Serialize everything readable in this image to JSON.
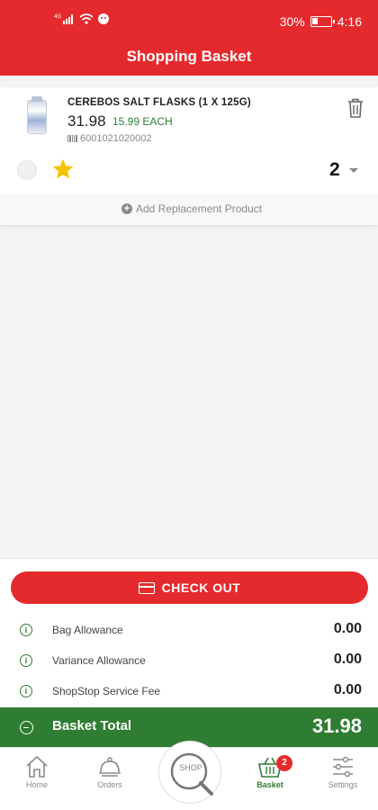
{
  "status_bar": {
    "battery": "30%",
    "time": "4:16",
    "network": "4G"
  },
  "header": {
    "title": "Shopping Basket"
  },
  "basket_item": {
    "name": "CEREBOS SALT FLASKS (1 X 125G)",
    "price": "31.98",
    "unit_price": "15.99 EACH",
    "barcode": "6001021020002",
    "quantity": "2",
    "add_replacement": "Add Replacement Product"
  },
  "checkout": {
    "label": "CHECK OUT"
  },
  "fees": [
    {
      "label": "Bag Allowance",
      "value": "0.00"
    },
    {
      "label": "Variance Allowance",
      "value": "0.00"
    },
    {
      "label": "ShopStop Service Fee",
      "value": "0.00"
    }
  ],
  "total": {
    "label": "Basket Total",
    "value": "31.98"
  },
  "nav": {
    "home": "Home",
    "orders": "Orders",
    "shop": "SHOP",
    "basket": "Basket",
    "basket_badge": "2",
    "settings": "Settings"
  },
  "colors": {
    "brand_red": "#e52a2d",
    "brand_green": "#2e7d32",
    "star": "#f5c400"
  }
}
